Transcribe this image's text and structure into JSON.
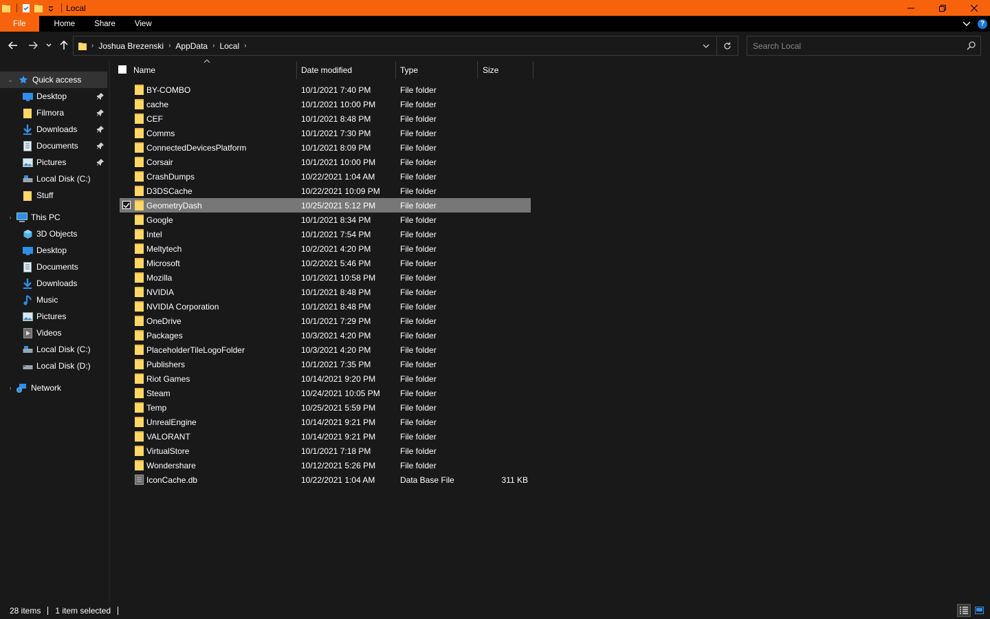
{
  "window": {
    "title": "Local"
  },
  "ribbon": {
    "tabs": [
      "File",
      "Home",
      "Share",
      "View"
    ]
  },
  "address": {
    "crumbs": [
      "Joshua Brezenski",
      "AppData",
      "Local"
    ]
  },
  "search": {
    "placeholder": "Search Local"
  },
  "sidebar": {
    "quick_access": {
      "label": "Quick access",
      "items": [
        {
          "label": "Desktop",
          "icon": "desktop-icon",
          "pinned": true
        },
        {
          "label": "Filmora",
          "icon": "folder-icon",
          "pinned": true
        },
        {
          "label": "Downloads",
          "icon": "downloads-icon",
          "pinned": true
        },
        {
          "label": "Documents",
          "icon": "documents-icon",
          "pinned": true
        },
        {
          "label": "Pictures",
          "icon": "pictures-icon",
          "pinned": true
        },
        {
          "label": "Local Disk (C:)",
          "icon": "drive-icon",
          "pinned": false
        },
        {
          "label": "Stuff",
          "icon": "folder-icon",
          "pinned": false
        }
      ]
    },
    "this_pc": {
      "label": "This PC",
      "items": [
        {
          "label": "3D Objects",
          "icon": "3d-objects-icon"
        },
        {
          "label": "Desktop",
          "icon": "desktop-icon"
        },
        {
          "label": "Documents",
          "icon": "documents-icon"
        },
        {
          "label": "Downloads",
          "icon": "downloads-icon"
        },
        {
          "label": "Music",
          "icon": "music-icon"
        },
        {
          "label": "Pictures",
          "icon": "pictures-icon"
        },
        {
          "label": "Videos",
          "icon": "videos-icon"
        },
        {
          "label": "Local Disk (C:)",
          "icon": "drive-icon"
        },
        {
          "label": "Local Disk (D:)",
          "icon": "drive-icon"
        }
      ]
    },
    "network": {
      "label": "Network"
    }
  },
  "columns": {
    "name": "Name",
    "date": "Date modified",
    "type": "Type",
    "size": "Size"
  },
  "files": [
    {
      "name": "BY-COMBO",
      "date": "10/1/2021 7:40 PM",
      "type": "File folder",
      "size": ""
    },
    {
      "name": "cache",
      "date": "10/1/2021 10:00 PM",
      "type": "File folder",
      "size": ""
    },
    {
      "name": "CEF",
      "date": "10/1/2021 8:48 PM",
      "type": "File folder",
      "size": ""
    },
    {
      "name": "Comms",
      "date": "10/1/2021 7:30 PM",
      "type": "File folder",
      "size": ""
    },
    {
      "name": "ConnectedDevicesPlatform",
      "date": "10/1/2021 8:09 PM",
      "type": "File folder",
      "size": ""
    },
    {
      "name": "Corsair",
      "date": "10/1/2021 10:00 PM",
      "type": "File folder",
      "size": ""
    },
    {
      "name": "CrashDumps",
      "date": "10/22/2021 1:04 AM",
      "type": "File folder",
      "size": ""
    },
    {
      "name": "D3DSCache",
      "date": "10/22/2021 10:09 PM",
      "type": "File folder",
      "size": ""
    },
    {
      "name": "GeometryDash",
      "date": "10/25/2021 5:12 PM",
      "type": "File folder",
      "size": "",
      "selected": true
    },
    {
      "name": "Google",
      "date": "10/1/2021 8:34 PM",
      "type": "File folder",
      "size": ""
    },
    {
      "name": "Intel",
      "date": "10/1/2021 7:54 PM",
      "type": "File folder",
      "size": ""
    },
    {
      "name": "Meltytech",
      "date": "10/2/2021 4:20 PM",
      "type": "File folder",
      "size": ""
    },
    {
      "name": "Microsoft",
      "date": "10/2/2021 5:46 PM",
      "type": "File folder",
      "size": ""
    },
    {
      "name": "Mozilla",
      "date": "10/1/2021 10:58 PM",
      "type": "File folder",
      "size": ""
    },
    {
      "name": "NVIDIA",
      "date": "10/1/2021 8:48 PM",
      "type": "File folder",
      "size": ""
    },
    {
      "name": "NVIDIA Corporation",
      "date": "10/1/2021 8:48 PM",
      "type": "File folder",
      "size": ""
    },
    {
      "name": "OneDrive",
      "date": "10/1/2021 7:29 PM",
      "type": "File folder",
      "size": ""
    },
    {
      "name": "Packages",
      "date": "10/3/2021 4:20 PM",
      "type": "File folder",
      "size": ""
    },
    {
      "name": "PlaceholderTileLogoFolder",
      "date": "10/3/2021 4:20 PM",
      "type": "File folder",
      "size": ""
    },
    {
      "name": "Publishers",
      "date": "10/1/2021 7:35 PM",
      "type": "File folder",
      "size": ""
    },
    {
      "name": "Riot Games",
      "date": "10/14/2021 9:20 PM",
      "type": "File folder",
      "size": ""
    },
    {
      "name": "Steam",
      "date": "10/24/2021 10:05 PM",
      "type": "File folder",
      "size": ""
    },
    {
      "name": "Temp",
      "date": "10/25/2021 5:59 PM",
      "type": "File folder",
      "size": ""
    },
    {
      "name": "UnrealEngine",
      "date": "10/14/2021 9:21 PM",
      "type": "File folder",
      "size": ""
    },
    {
      "name": "VALORANT",
      "date": "10/14/2021 9:21 PM",
      "type": "File folder",
      "size": ""
    },
    {
      "name": "VirtualStore",
      "date": "10/1/2021 7:18 PM",
      "type": "File folder",
      "size": ""
    },
    {
      "name": "Wondershare",
      "date": "10/12/2021 5:26 PM",
      "type": "File folder",
      "size": ""
    },
    {
      "name": "IconCache.db",
      "date": "10/22/2021 1:04 AM",
      "type": "Data Base File",
      "size": "311 KB",
      "kind": "file"
    }
  ],
  "status": {
    "items": "28 items",
    "selected": "1 item selected"
  },
  "colors": {
    "accent": "#f7630c",
    "selected_row": "#777777",
    "background": "#191919",
    "folder": "#ffd766"
  }
}
